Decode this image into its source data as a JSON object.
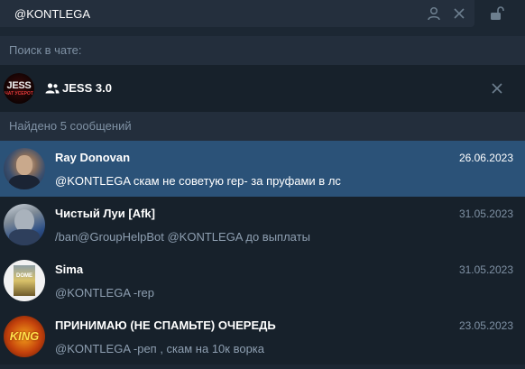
{
  "search": {
    "query": "@KONTLEGA",
    "icons": [
      "user-icon",
      "close-icon",
      "unlock-icon"
    ]
  },
  "labels": {
    "search_in_chat": "Поиск в чате:",
    "found": "Найдено 5 сообщений"
  },
  "chat": {
    "name": "JESS 3.0",
    "avatar_line1": "JESS",
    "avatar_line2": "ЧАТ УСЕРОТ",
    "icon": "group-icon"
  },
  "results": [
    {
      "name": "Ray Donovan",
      "date": "26.06.2023",
      "message": "@KONTLEGA скам не советую rep- за пруфами в лс",
      "active": true
    },
    {
      "name": "Чистый Луи [Afk]",
      "date": "31.05.2023",
      "message": "/ban@GroupHelpBot @KONTLEGA до выплаты",
      "active": false
    },
    {
      "name": "Sima",
      "date": "31.05.2023",
      "message": "@KONTLEGA -rep",
      "active": false,
      "avatar_text": "DOME"
    },
    {
      "name": "ПРИНИМАЮ (НЕ СПАМЬТЕ) ОЧЕРЕДЬ",
      "date": "23.05.2023",
      "message": "@KONTLEGA -реп , скам на 10к ворка",
      "active": false,
      "avatar_text": "KING"
    }
  ],
  "colors": {
    "background": "#17212b",
    "header": "#232e3c",
    "active_row": "#2b5278",
    "muted_text": "#7f91a4"
  }
}
